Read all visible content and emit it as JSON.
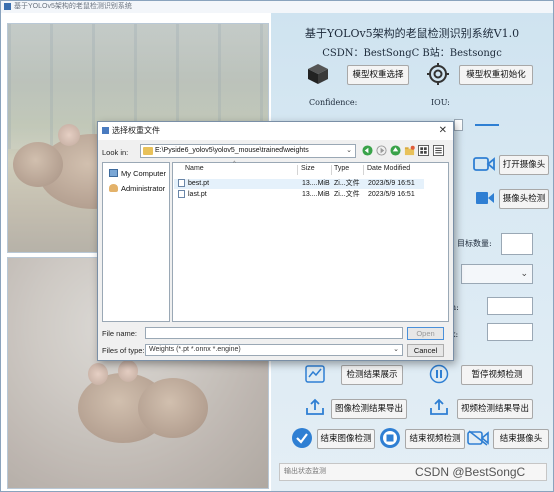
{
  "window": {
    "title": "基于YOLOv5架构的老鼠检测识别系统"
  },
  "app": {
    "title": "基于YOLOv5架构的老鼠检测识别系统V1.0",
    "subtitle": "CSDN：BestSongC  B站：Bestsongc",
    "buttons": {
      "select_weights": "模型权重选择",
      "init_model": "模型权重初始化",
      "open_camera": "打开摄像头",
      "camera_detect": "摄像头检测",
      "show_results": "检测结果展示",
      "pause_video": "暂停视频检测",
      "export_image": "图像检测结果导出",
      "export_video": "视频检测结果导出",
      "end_image": "结束图像检测",
      "end_video": "结束视频检测",
      "close_camera": "结束摄像头"
    },
    "labels": {
      "confidence": "Confidence:",
      "iou": "IOU:",
      "target_count": "目标数量:",
      "partial_a": "n:",
      "partial_b": "x:"
    },
    "status_placeholder": "输出状态监测"
  },
  "dialog": {
    "title": "选择权重文件",
    "close": "✕",
    "look_in_label": "Look in:",
    "look_in_path": "E:\\Pyside6_yolov5\\yolov5_mouse\\trained\\weights",
    "sidebar": [
      {
        "label": "My Computer",
        "icon": "computer-icon"
      },
      {
        "label": "Administrator",
        "icon": "user-icon"
      }
    ],
    "columns": [
      "Name",
      "Size",
      "Type",
      "Date Modified"
    ],
    "files": [
      {
        "name": "best.pt",
        "size": "13....MiB",
        "type": "Zi...文件",
        "date": "2023/5/9 16:51"
      },
      {
        "name": "last.pt",
        "size": "13....MiB",
        "type": "Zi...文件",
        "date": "2023/5/9 16:51"
      }
    ],
    "file_name_label": "File name:",
    "file_name_value": "",
    "file_type_label": "Files of type:",
    "file_type_value": "Weights (*.pt *.onnx *.engine)",
    "open_button": "Open",
    "cancel_button": "Cancel"
  },
  "watermark": "CSDN @BestSongC",
  "colors": {
    "accent": "#2f7fd3",
    "panel_bg": "#d6e8f3",
    "selection": "#e5f1fb"
  }
}
